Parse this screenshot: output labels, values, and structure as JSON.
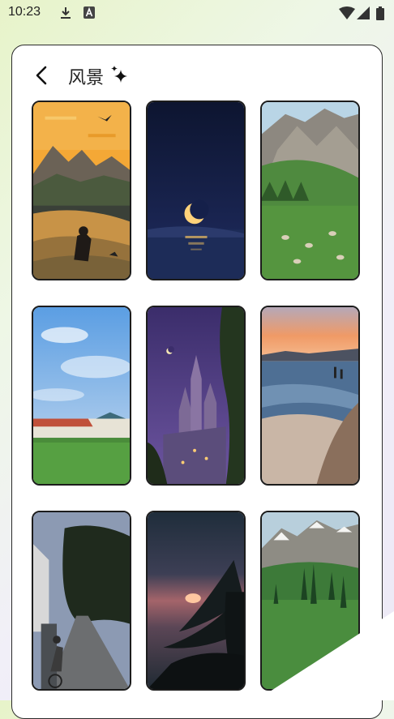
{
  "status_bar": {
    "time": "10:23",
    "icons": [
      "download-icon",
      "a-badge-icon",
      "wifi-icon",
      "signal-icon",
      "battery-icon"
    ]
  },
  "header": {
    "title": "风景",
    "back_icon": "back-arrow-icon",
    "decoration_icon": "sparkle-icon"
  },
  "wallpapers": [
    {
      "name": "sunset-mountains-with-bird"
    },
    {
      "name": "crescent-moon-over-water"
    },
    {
      "name": "rocky-mountain-with-sheep-pasture"
    },
    {
      "name": "blue-sky-football-field"
    },
    {
      "name": "castle-at-night"
    },
    {
      "name": "beach-at-sunset"
    },
    {
      "name": "tree-lined-street-with-cyclist"
    },
    {
      "name": "palm-tree-at-dusk"
    },
    {
      "name": "snowy-mountain-with-cypress-trees"
    }
  ],
  "colors": {
    "card_border": "#2b2b2b",
    "thumb_border": "#1c1c1c",
    "background_start": "#e7f3c9",
    "background_end": "#ece8f6"
  }
}
